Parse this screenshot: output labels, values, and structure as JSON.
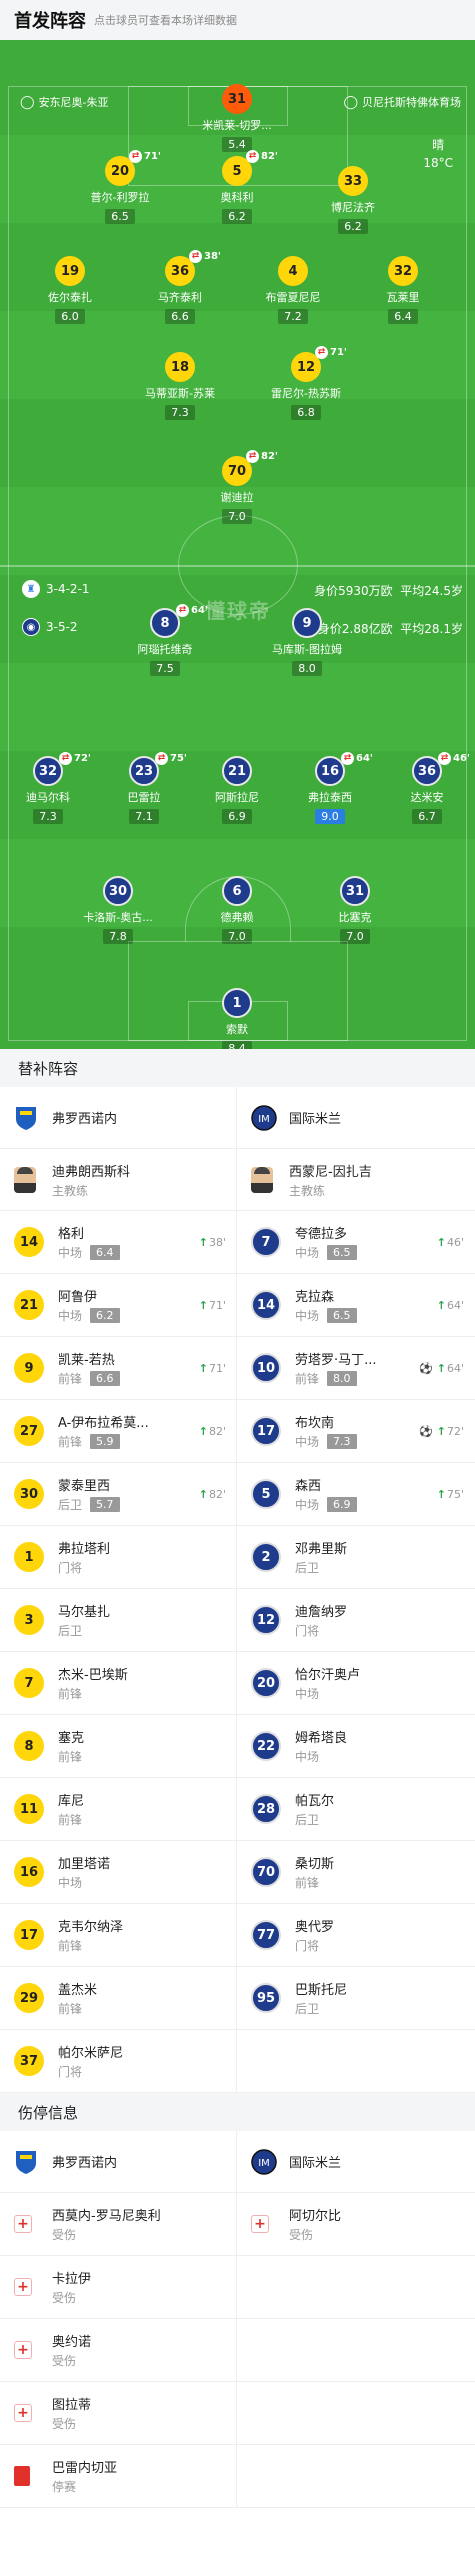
{
  "header": {
    "title": "首发阵容",
    "subtitle": "点击球员可查看本场详细数据"
  },
  "pitch": {
    "venue_left": "安东尼奥-朱亚",
    "venue_right": "贝尼托斯特佛体育场",
    "weather": "晴",
    "temperature": "18°C",
    "home_formation": "3-4-2-1",
    "home_value": "身价5930万欧",
    "home_age": "平均24.5岁",
    "away_formation": "3-5-2",
    "away_value": "身价2.88亿欧",
    "away_age": "平均28.1岁",
    "watermark": "懂球帝"
  },
  "home_players": [
    {
      "num": "31",
      "name": "米凯莱-切罗...",
      "rating": "5.4",
      "style": "org"
    },
    {
      "num": "20",
      "name": "普尔-利罗拉",
      "rating": "6.5",
      "style": "yel",
      "sub": "71'"
    },
    {
      "num": "5",
      "name": "奥科利",
      "rating": "6.2",
      "style": "yel",
      "sub": "82'"
    },
    {
      "num": "33",
      "name": "博尼法齐",
      "rating": "6.2",
      "style": "yel"
    },
    {
      "num": "19",
      "name": "佐尔泰扎",
      "rating": "6.0",
      "style": "yel"
    },
    {
      "num": "36",
      "name": "马齐泰利",
      "rating": "6.6",
      "style": "yel",
      "sub": "38'"
    },
    {
      "num": "4",
      "name": "布雷夏尼尼",
      "rating": "7.2",
      "style": "yel"
    },
    {
      "num": "32",
      "name": "瓦莱里",
      "rating": "6.4",
      "style": "yel"
    },
    {
      "num": "18",
      "name": "马蒂亚斯-苏莱",
      "rating": "7.3",
      "style": "yel"
    },
    {
      "num": "12",
      "name": "雷尼尔-热苏斯",
      "rating": "6.8",
      "style": "yel",
      "sub": "71'"
    },
    {
      "num": "70",
      "name": "谢迪拉",
      "rating": "7.0",
      "style": "yel",
      "sub": "82'"
    }
  ],
  "away_players": [
    {
      "num": "8",
      "name": "阿瑙托维奇",
      "rating": "7.5",
      "sub": "64'"
    },
    {
      "num": "9",
      "name": "马库斯-图拉姆",
      "rating": "8.0"
    },
    {
      "num": "32",
      "name": "迪马尔科",
      "rating": "7.3",
      "sub": "72'"
    },
    {
      "num": "23",
      "name": "巴雷拉",
      "rating": "7.1",
      "sub": "75'"
    },
    {
      "num": "21",
      "name": "阿斯拉尼",
      "rating": "6.9"
    },
    {
      "num": "16",
      "name": "弗拉泰西",
      "rating": "9.0",
      "sub": "64'"
    },
    {
      "num": "36",
      "name": "达米安",
      "rating": "6.7",
      "sub": "46'"
    },
    {
      "num": "30",
      "name": "卡洛斯-奥古...",
      "rating": "7.8"
    },
    {
      "num": "6",
      "name": "德弗赖",
      "rating": "7.0"
    },
    {
      "num": "31",
      "name": "比塞克",
      "rating": "7.0"
    },
    {
      "num": "1",
      "name": "索默",
      "rating": "8.4"
    }
  ],
  "subs": {
    "title": "替补阵容",
    "home_team": "弗罗西诺内",
    "away_team": "国际米兰",
    "home_coach": "迪弗朗西斯科",
    "away_coach": "西蒙尼-因扎吉",
    "coach_label": "主教练",
    "rows": [
      {
        "h": {
          "num": "14",
          "name": "格利",
          "pos": "中场",
          "rating": "6.4",
          "time": "38'"
        },
        "a": {
          "num": "7",
          "name": "夸德拉多",
          "pos": "中场",
          "rating": "6.5",
          "time": "46'"
        }
      },
      {
        "h": {
          "num": "21",
          "name": "阿鲁伊",
          "pos": "中场",
          "rating": "6.2",
          "time": "71'"
        },
        "a": {
          "num": "14",
          "name": "克拉森",
          "pos": "中场",
          "rating": "6.5",
          "time": "64'"
        }
      },
      {
        "h": {
          "num": "9",
          "name": "凯莱-若热",
          "pos": "前锋",
          "rating": "6.6",
          "time": "71'"
        },
        "a": {
          "num": "10",
          "name": "劳塔罗·马丁...",
          "pos": "前锋",
          "rating": "8.0",
          "time": "64'",
          "goal": true
        }
      },
      {
        "h": {
          "num": "27",
          "name": "A-伊布拉希莫...",
          "pos": "前锋",
          "rating": "5.9",
          "time": "82'"
        },
        "a": {
          "num": "17",
          "name": "布坎南",
          "pos": "中场",
          "rating": "7.3",
          "time": "72'",
          "goal": true
        }
      },
      {
        "h": {
          "num": "30",
          "name": "蒙泰里西",
          "pos": "后卫",
          "rating": "5.7",
          "time": "82'"
        },
        "a": {
          "num": "5",
          "name": "森西",
          "pos": "中场",
          "rating": "6.9",
          "time": "75'"
        }
      },
      {
        "h": {
          "num": "1",
          "name": "弗拉塔利",
          "pos": "门将"
        },
        "a": {
          "num": "2",
          "name": "邓弗里斯",
          "pos": "后卫"
        }
      },
      {
        "h": {
          "num": "3",
          "name": "马尔基扎",
          "pos": "后卫"
        },
        "a": {
          "num": "12",
          "name": "迪詹纳罗",
          "pos": "门将"
        }
      },
      {
        "h": {
          "num": "7",
          "name": "杰米-巴埃斯",
          "pos": "前锋"
        },
        "a": {
          "num": "20",
          "name": "恰尔汗奥卢",
          "pos": "中场"
        }
      },
      {
        "h": {
          "num": "8",
          "name": "塞克",
          "pos": "前锋"
        },
        "a": {
          "num": "22",
          "name": "姆希塔良",
          "pos": "中场"
        }
      },
      {
        "h": {
          "num": "11",
          "name": "库尼",
          "pos": "前锋"
        },
        "a": {
          "num": "28",
          "name": "帕瓦尔",
          "pos": "后卫"
        }
      },
      {
        "h": {
          "num": "16",
          "name": "加里塔诺",
          "pos": "中场"
        },
        "a": {
          "num": "70",
          "name": "桑切斯",
          "pos": "前锋"
        }
      },
      {
        "h": {
          "num": "17",
          "name": "克韦尔纳泽",
          "pos": "前锋"
        },
        "a": {
          "num": "77",
          "name": "奥代罗",
          "pos": "门将"
        }
      },
      {
        "h": {
          "num": "29",
          "name": "盖杰米",
          "pos": "前锋"
        },
        "a": {
          "num": "95",
          "name": "巴斯托尼",
          "pos": "后卫"
        }
      },
      {
        "h": {
          "num": "37",
          "name": "帕尔米萨尼",
          "pos": "门将"
        },
        "a": null
      }
    ]
  },
  "injuries": {
    "title": "伤停信息",
    "home_team": "弗罗西诺内",
    "away_team": "国际米兰",
    "home": [
      {
        "name": "西莫内-罗马尼奥利",
        "status": "受伤",
        "type": "injury"
      },
      {
        "name": "卡拉伊",
        "status": "受伤",
        "type": "injury"
      },
      {
        "name": "奥约诺",
        "status": "受伤",
        "type": "injury"
      },
      {
        "name": "图拉蒂",
        "status": "受伤",
        "type": "injury"
      },
      {
        "name": "巴雷内切亚",
        "status": "停赛",
        "type": "red"
      }
    ],
    "away": [
      {
        "name": "阿切尔比",
        "status": "受伤",
        "type": "injury"
      }
    ]
  },
  "colors": {
    "pitch": "#3eab3a",
    "home_badge": "#ffd60a",
    "gk_badge": "#ff5c0a",
    "inter": "#1e3b8c"
  }
}
